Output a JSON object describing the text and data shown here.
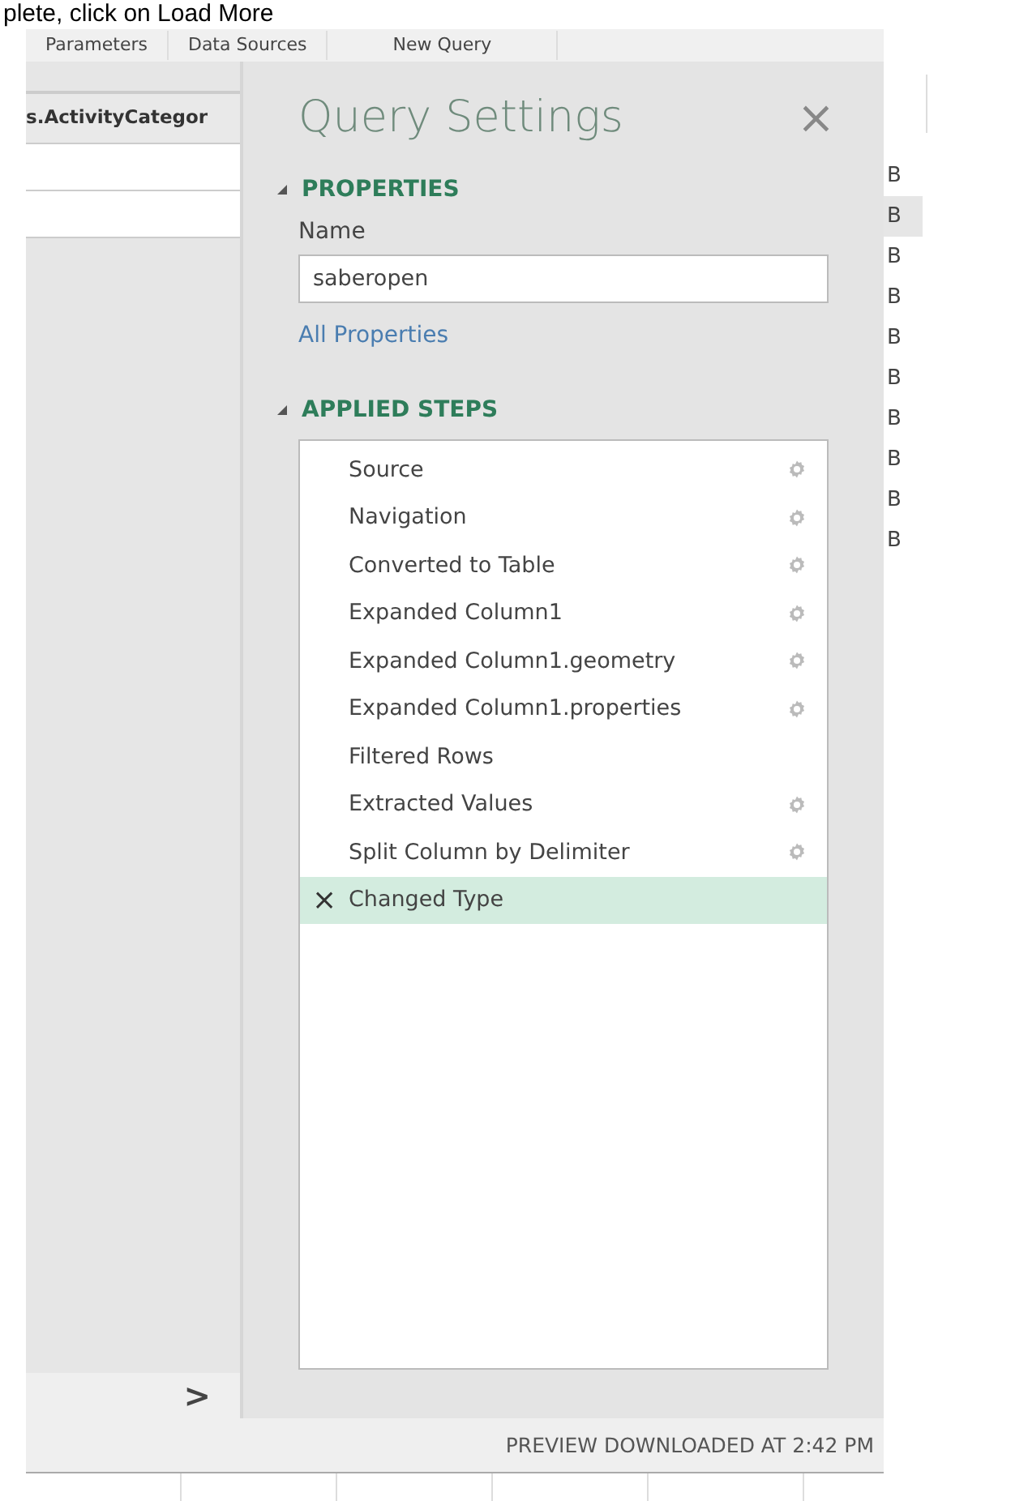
{
  "top_text": "plete, click on Load More",
  "tabs": [
    {
      "label": "Parameters"
    },
    {
      "label": "Data Sources"
    },
    {
      "label": "New Query"
    }
  ],
  "left_pane": {
    "column_header": "s.ActivityCategor",
    "scroll_arrow": ">"
  },
  "query_settings": {
    "title": "Query Settings",
    "close": "×",
    "properties": {
      "heading": "PROPERTIES",
      "expanded": true,
      "name_label": "Name",
      "name_value": "saberopen",
      "link": "All Properties"
    },
    "applied_steps": {
      "heading": "APPLIED STEPS",
      "expanded": true,
      "steps": [
        {
          "label": "Source",
          "has_settings": true,
          "selected": false
        },
        {
          "label": "Navigation",
          "has_settings": true,
          "selected": false
        },
        {
          "label": "Converted to Table",
          "has_settings": true,
          "selected": false
        },
        {
          "label": "Expanded Column1",
          "has_settings": true,
          "selected": false
        },
        {
          "label": "Expanded Column1.geometry",
          "has_settings": true,
          "selected": false
        },
        {
          "label": "Expanded Column1.properties",
          "has_settings": true,
          "selected": false
        },
        {
          "label": "Filtered Rows",
          "has_settings": false,
          "selected": false
        },
        {
          "label": "Extracted Values",
          "has_settings": true,
          "selected": false
        },
        {
          "label": "Split Column by Delimiter",
          "has_settings": true,
          "selected": false
        },
        {
          "label": "Changed Type",
          "has_settings": false,
          "selected": true,
          "delete": "×"
        }
      ]
    }
  },
  "size_column": [
    {
      "text": "B",
      "selected": false
    },
    {
      "text": "B",
      "selected": true
    },
    {
      "text": "B",
      "selected": false
    },
    {
      "text": "B",
      "selected": false
    },
    {
      "text": "B",
      "selected": false
    },
    {
      "text": "B",
      "selected": false
    },
    {
      "text": "B",
      "selected": false
    },
    {
      "text": "B",
      "selected": false
    },
    {
      "text": "B",
      "selected": false
    },
    {
      "text": "B",
      "selected": false
    }
  ],
  "status_bar": "PREVIEW DOWNLOADED AT 2:42 PM"
}
